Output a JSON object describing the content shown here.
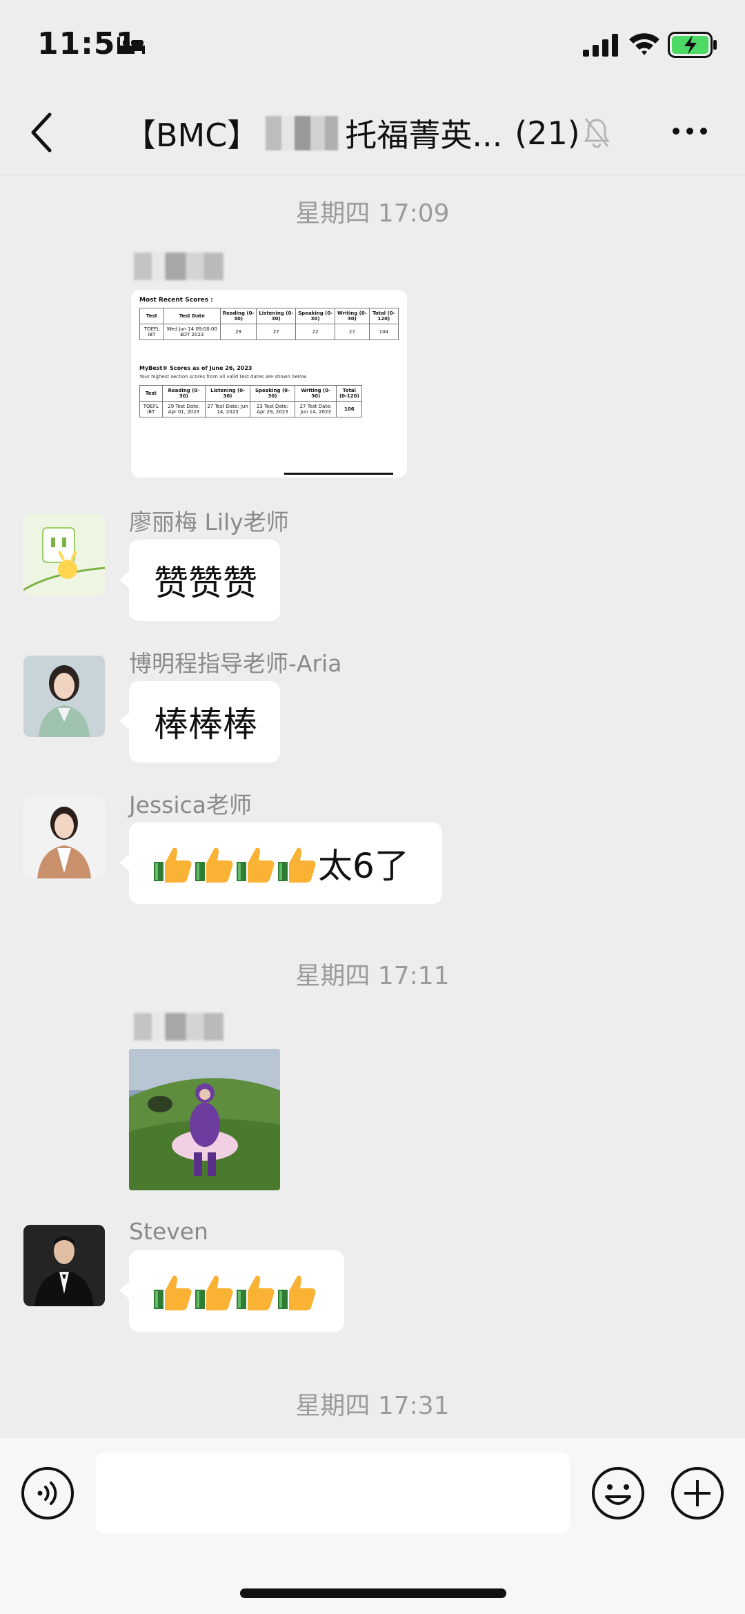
{
  "status_bar": {
    "time": "11:51"
  },
  "nav": {
    "title_prefix": "【BMC】",
    "title_suffix": "托福菁英...",
    "member_count": "(21)"
  },
  "messages": {
    "ts1": "星期四 17:09",
    "score_image": {
      "recent_title": "Most Recent Scores :",
      "recent_headers": [
        "Test",
        "Test Date",
        "Reading (0-30)",
        "Listening (0-30)",
        "Speaking (0-30)",
        "Writing (0-30)",
        "Total (0-120)"
      ],
      "recent_row": [
        "TOEFL iBT",
        "Wed Jun 14 09:00:00 EDT 2023",
        "29",
        "27",
        "22",
        "27",
        "104"
      ],
      "mybest_title": "MyBest® Scores as of June 26, 2023",
      "mybest_note": "Your highest section scores from all valid test dates are shown below.",
      "mybest_headers": [
        "Test",
        "Reading (0-30)",
        "Listening (0-30)",
        "Speaking (0-30)",
        "Writing (0-30)",
        "Total (0-120)"
      ],
      "mybest_row": [
        "TOEFL iBT",
        "29 Test Date: Apr 01, 2023",
        "27 Test Date: Jun 14, 2023",
        "23 Test Date: Apr 29, 2023",
        "27 Test Date: Jun 14, 2023",
        "106"
      ]
    },
    "lily": {
      "name": "廖丽梅 Lily老师",
      "text": "赞赞赞"
    },
    "aria": {
      "name": "博明程指导老师-Aria",
      "text": "棒棒棒"
    },
    "jessica": {
      "name": "Jessica老师",
      "text_suffix": "太6了"
    },
    "ts2": "星期四 17:11",
    "steven": {
      "name": "Steven"
    },
    "ts3": "星期四 17:31"
  },
  "colors": {
    "background": "#ededed",
    "bubble": "#ffffff",
    "battery": "#4cd964"
  }
}
